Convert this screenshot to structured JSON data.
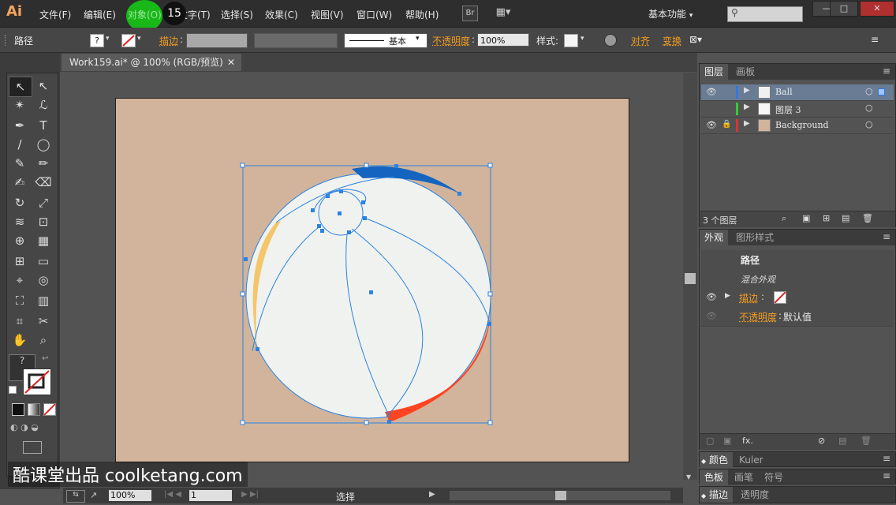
{
  "app": {
    "logo": "Ai"
  },
  "menu": [
    "文件(F)",
    "编辑(E)",
    "对象(O)",
    "文字(T)",
    "选择(S)",
    "效果(C)",
    "视图(V)",
    "窗口(W)",
    "帮助(H)"
  ],
  "step_badge": "15",
  "top_buttons": {
    "bridge": "Br",
    "arrange": "▦▾"
  },
  "workspace": "基本功能",
  "window_controls": {
    "min": "—",
    "max": "□",
    "close": "✕"
  },
  "control_bar": {
    "object_type": "路径",
    "fill_swatch": "?",
    "stroke_label": "描边",
    "stroke_style": "基本",
    "opacity_label": "不透明度",
    "opacity_value": "100%",
    "style_label": "样式",
    "align_label": "对齐",
    "transform_label": "变换",
    "accent_color": "#f29c1f"
  },
  "document": {
    "tab_title": "Work159.ai* @ 100% (RGB/预览)",
    "close": "✕"
  },
  "artwork": {
    "artboard_color": "#d1b49b",
    "ball_fill": "#f0f2f0",
    "blue_arc": "#1565c0",
    "red_arc": "#ff4422",
    "yellow_arc": "#f4c66a",
    "selection_color": "#2b82e0"
  },
  "layers_panel": {
    "tabs": [
      "图层",
      "画板"
    ],
    "layers": [
      {
        "name": "Ball",
        "color": "#3477e0",
        "visible": true,
        "locked": false,
        "selected": true,
        "thumb": "#f0f0f0"
      },
      {
        "name": "图层 3",
        "color": "#33cc33",
        "visible": false,
        "locked": false,
        "selected": false,
        "thumb": "#f7f7f7"
      },
      {
        "name": "Background",
        "color": "#dd3333",
        "visible": true,
        "locked": true,
        "selected": false,
        "thumb": "#d1b49b"
      }
    ],
    "count": "3 个图层"
  },
  "appearance_panel": {
    "tabs": [
      "外观",
      "图形样式"
    ],
    "title": "路径",
    "subtitle": "混合外观",
    "stroke_label": "描边",
    "opacity_label": "不透明度",
    "opacity_value": "默认值",
    "fx": "fx."
  },
  "collapsed_panels": [
    {
      "tabs": [
        "颜色",
        "Kuler"
      ]
    },
    {
      "tabs": [
        "色板",
        "画笔",
        "符号"
      ]
    },
    {
      "tabs": [
        "描边",
        "透明度"
      ]
    }
  ],
  "status_bar": {
    "zoom": "100%",
    "page": "1",
    "tool": "选择"
  },
  "watermark": "酷课堂出品 coolketang.com"
}
